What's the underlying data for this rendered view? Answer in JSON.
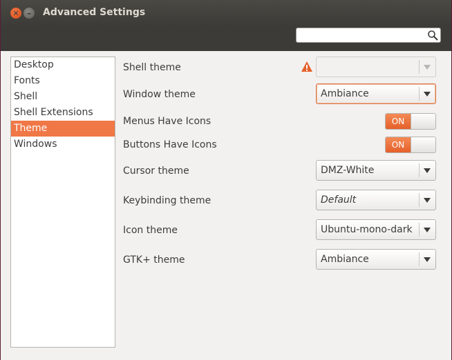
{
  "window": {
    "title": "Advanced Settings"
  },
  "search": {
    "value": "",
    "placeholder": ""
  },
  "sidebar": {
    "items": [
      {
        "label": "Desktop"
      },
      {
        "label": "Fonts"
      },
      {
        "label": "Shell"
      },
      {
        "label": "Shell Extensions"
      },
      {
        "label": "Theme",
        "selected": true
      },
      {
        "label": "Windows"
      }
    ]
  },
  "theme": {
    "rows": [
      {
        "label": "Shell theme",
        "type": "combo",
        "value": "",
        "disabled": true,
        "warning": true
      },
      {
        "label": "Window theme",
        "type": "combo",
        "value": "Ambiance",
        "focused": true
      },
      {
        "label": "Menus Have Icons",
        "type": "switch",
        "value": "ON"
      },
      {
        "label": "Buttons Have Icons",
        "type": "switch",
        "value": "ON"
      },
      {
        "label": "Cursor theme",
        "type": "combo",
        "value": "DMZ-White"
      },
      {
        "label": "Keybinding theme",
        "type": "combo",
        "value": "Default",
        "italic": true
      },
      {
        "label": "Icon theme",
        "type": "combo",
        "value": "Ubuntu-mono-dark"
      },
      {
        "label": "GTK+ theme",
        "type": "combo",
        "value": "Ambiance"
      }
    ]
  },
  "colors": {
    "accent": "#f07746",
    "titlebar": "#3c3b37",
    "warning": "#e5602a"
  },
  "icons": {
    "close": "close-icon",
    "minimize": "minimize-icon",
    "search": "search-icon",
    "warning": "warning-icon",
    "dropdown": "chevron-down-icon"
  }
}
